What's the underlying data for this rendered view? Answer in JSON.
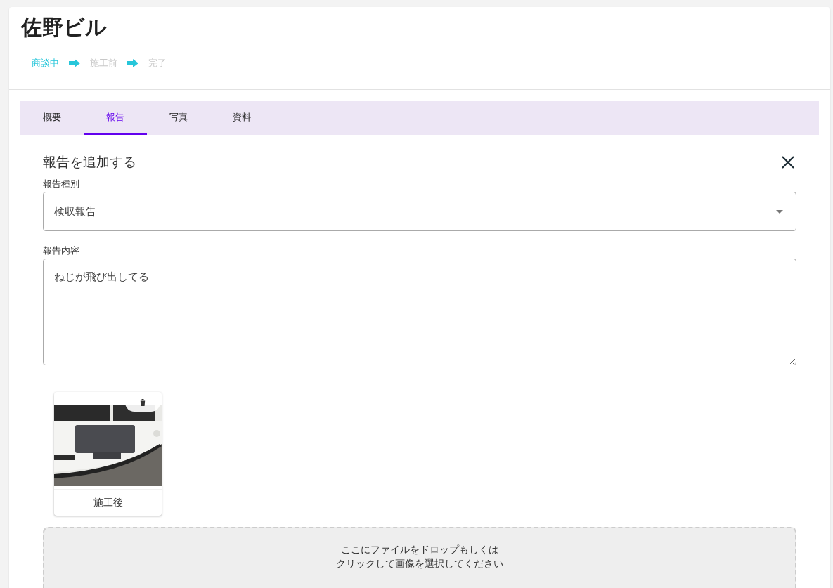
{
  "title": "佐野ビル",
  "steps": [
    {
      "label": "商談中",
      "active": true
    },
    {
      "label": "施工前",
      "active": false
    },
    {
      "label": "完了",
      "active": false
    }
  ],
  "tabs": [
    {
      "label": "概要",
      "selected": false
    },
    {
      "label": "報告",
      "selected": true
    },
    {
      "label": "写真",
      "selected": false
    },
    {
      "label": "資料",
      "selected": false
    }
  ],
  "form": {
    "heading": "報告を追加する",
    "type_label": "報告種別",
    "type_value": "検収報告",
    "content_label": "報告内容",
    "content_value": "ねじが飛び出してる"
  },
  "photos": [
    {
      "kind": "picture",
      "caption": "施工後"
    }
  ],
  "dropzone": {
    "lines": [
      "ここにファイルをドロップもしくは",
      "クリックして画像を選択してください"
    ]
  }
}
